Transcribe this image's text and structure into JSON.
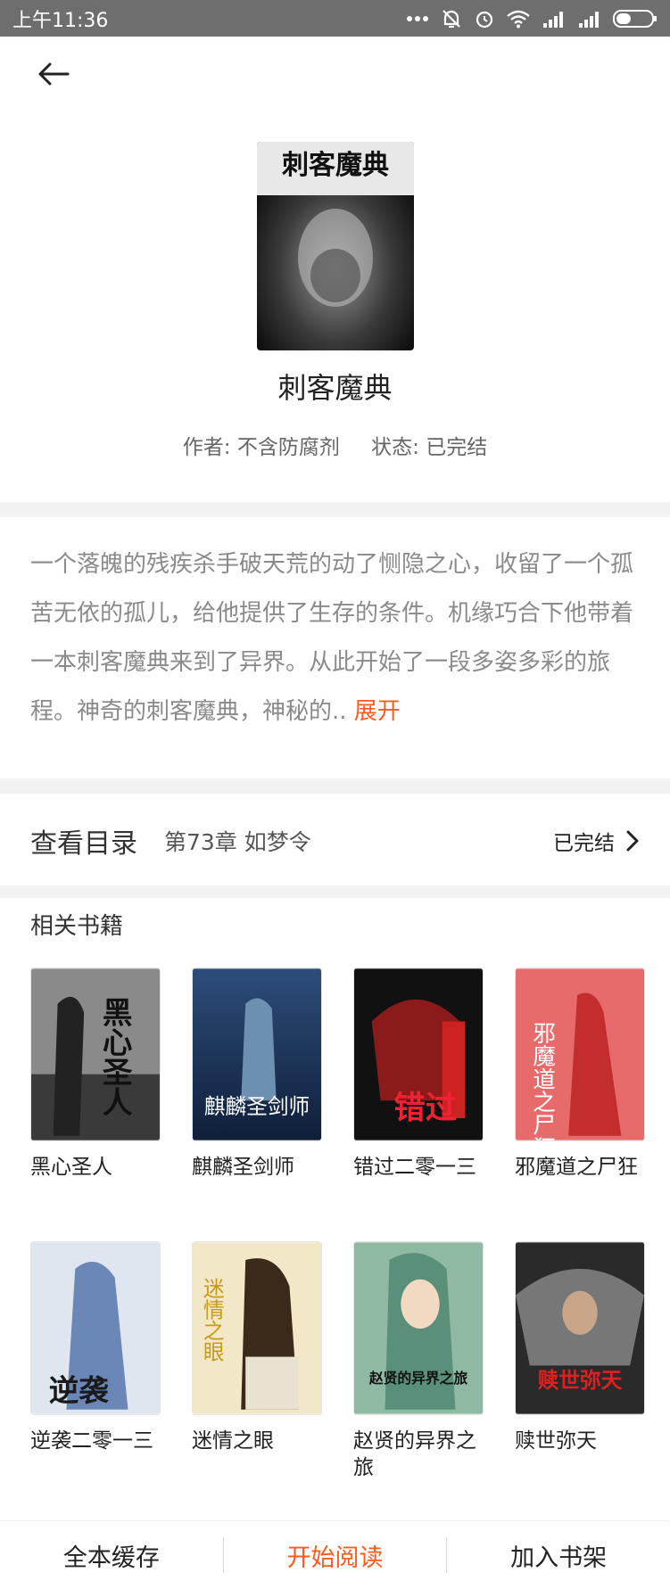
{
  "status_bar": {
    "time": "上午11:36"
  },
  "book": {
    "title": "刺客魔典",
    "cover_text": "刺客魔典",
    "author_label": "作者: 不含防腐剂",
    "status_label": "状态: 已完结",
    "description": "一个落魄的残疾杀手破天荒的动了恻隐之心，收留了一个孤苦无依的孤儿，给他提供了生存的条件。机缘巧合下他带着一本刺客魔典来到了异界。从此开始了一段多姿多彩的旅程。神奇的刺客魔典，神秘的..",
    "expand_label": "展开"
  },
  "catalog": {
    "label": "查看目录",
    "latest_chapter": "第73章  如梦令",
    "status": "已完结"
  },
  "related": {
    "title": "相关书籍",
    "books": [
      {
        "name": "黑心圣人",
        "cover_text": "黑心圣人"
      },
      {
        "name": "麒麟圣剑师",
        "cover_text": "麒麟圣剑师"
      },
      {
        "name": "错过二零一三",
        "cover_text": "错过"
      },
      {
        "name": "邪魔道之尸狂",
        "cover_text": "邪魔道之尸狂"
      },
      {
        "name": "逆袭二零一三",
        "cover_text": "逆袭"
      },
      {
        "name": "迷情之眼",
        "cover_text": "迷情之眼"
      },
      {
        "name": "赵贤的异界之旅",
        "cover_text": "赵贤的异界之旅"
      },
      {
        "name": "赎世弥天",
        "cover_text": "赎世弥天"
      }
    ]
  },
  "bottom_bar": {
    "cache_label": "全本缓存",
    "read_label": "开始阅读",
    "shelf_label": "加入书架"
  },
  "colors": {
    "accent": "#ff5a1f",
    "status_bar": "#6e6e6e",
    "divider": "#f2f2f2"
  }
}
